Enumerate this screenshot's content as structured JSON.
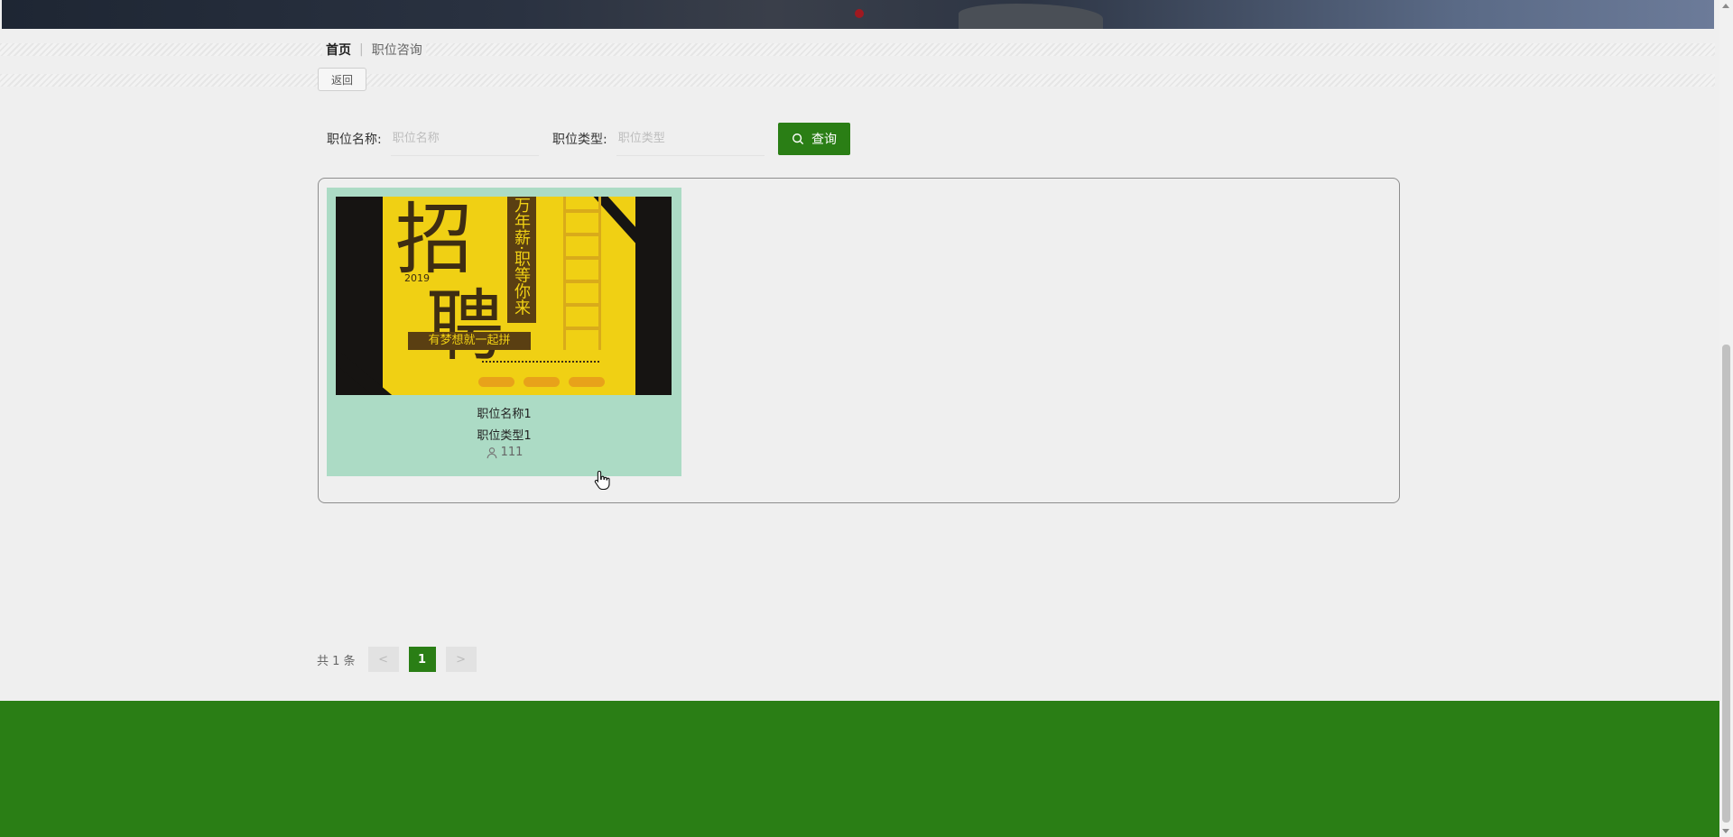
{
  "breadcrumb": {
    "home": "首页",
    "separator": "|",
    "current": "职位咨询"
  },
  "back_label": "返回",
  "search": {
    "name_label": "职位名称:",
    "name_placeholder": "职位名称",
    "type_label": "职位类型:",
    "type_placeholder": "职位类型",
    "button_label": "查询"
  },
  "cards": [
    {
      "title": "职位名称1",
      "type": "职位类型1",
      "views": "111",
      "poster": {
        "big_text_top": "招",
        "big_text_bottom": "聘",
        "vertical_text": "万年薪·职等你来",
        "year": "2019",
        "motto": "有梦想就一起拼"
      }
    }
  ],
  "pagination": {
    "total_text": "共 1 条",
    "prev": "<",
    "current_page": "1",
    "next": ">"
  },
  "colors": {
    "accent": "#2a7e15",
    "card_bg": "#acdbc5",
    "page_bg": "#efefef"
  },
  "icons": {
    "search": "search-icon",
    "views": "user-icon"
  }
}
